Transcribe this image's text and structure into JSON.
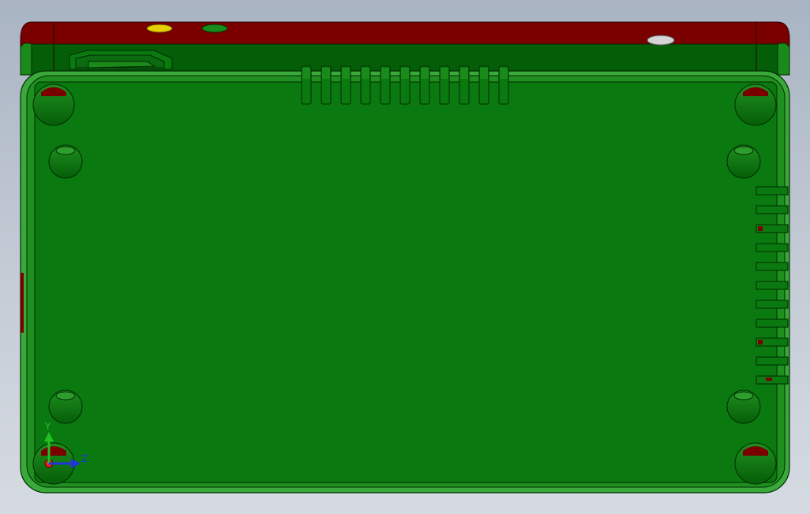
{
  "colors": {
    "background_top": "#a9b4c3",
    "background_bottom": "#d6dbe2",
    "body_green": "#0a7a10",
    "edge_green": "#3aa83a",
    "dark_green": "#045e08",
    "lid_red": "#7a0000",
    "accent_yellow": "#e6d000",
    "port_grey": "#d4d4d4",
    "axis_y": "#22c022",
    "axis_z": "#2233dd",
    "axis_x": "#dd2222"
  },
  "triad": {
    "y_label": "Y",
    "z_label": "Z"
  }
}
